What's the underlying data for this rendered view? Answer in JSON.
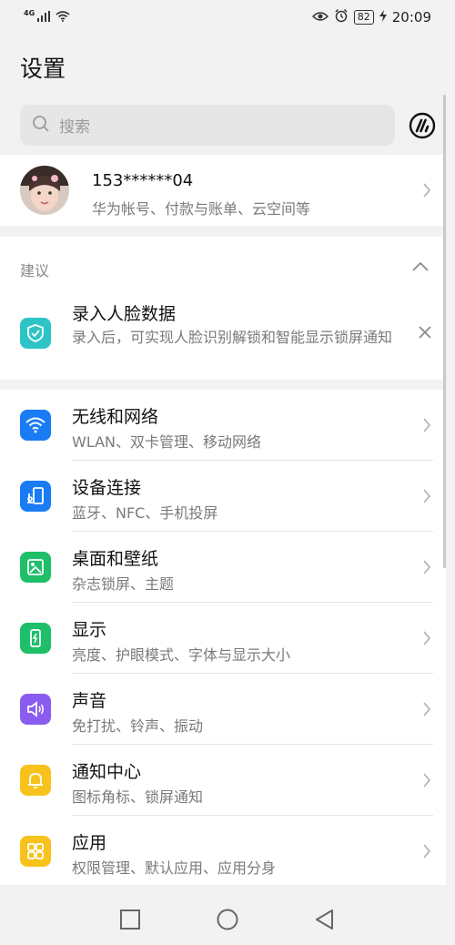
{
  "status_bar": {
    "network": "4G",
    "battery": "82",
    "time": "20:09"
  },
  "page": {
    "title": "设置"
  },
  "search": {
    "placeholder": "搜索"
  },
  "account": {
    "name": "153******04",
    "subtitle": "华为帐号、付款与账单、云空间等"
  },
  "suggestion": {
    "section_title": "建议",
    "title": "录入人脸数据",
    "description": "录入后，可实现人脸识别解锁和智能显示锁屏通知",
    "icon": "shield-check-icon",
    "color": "#2ec4c6"
  },
  "settings_items": [
    {
      "title": "无线和网络",
      "subtitle": "WLAN、双卡管理、移动网络",
      "icon": "wifi-icon",
      "color": "#1a7cf5"
    },
    {
      "title": "设备连接",
      "subtitle": "蓝牙、NFC、手机投屏",
      "icon": "device-connect-icon",
      "color": "#1a7cf5"
    },
    {
      "title": "桌面和壁纸",
      "subtitle": "杂志锁屏、主题",
      "icon": "wallpaper-icon",
      "color": "#1fbf6a"
    },
    {
      "title": "显示",
      "subtitle": "亮度、护眼模式、字体与显示大小",
      "icon": "display-icon",
      "color": "#1fbf6a"
    },
    {
      "title": "声音",
      "subtitle": "免打扰、铃声、振动",
      "icon": "speaker-icon",
      "color": "#8a5cf0"
    },
    {
      "title": "通知中心",
      "subtitle": "图标角标、锁屏通知",
      "icon": "bell-icon",
      "color": "#f7c21b"
    },
    {
      "title": "应用",
      "subtitle": "权限管理、默认应用、应用分身",
      "icon": "apps-grid-icon",
      "color": "#f7c21b"
    }
  ]
}
